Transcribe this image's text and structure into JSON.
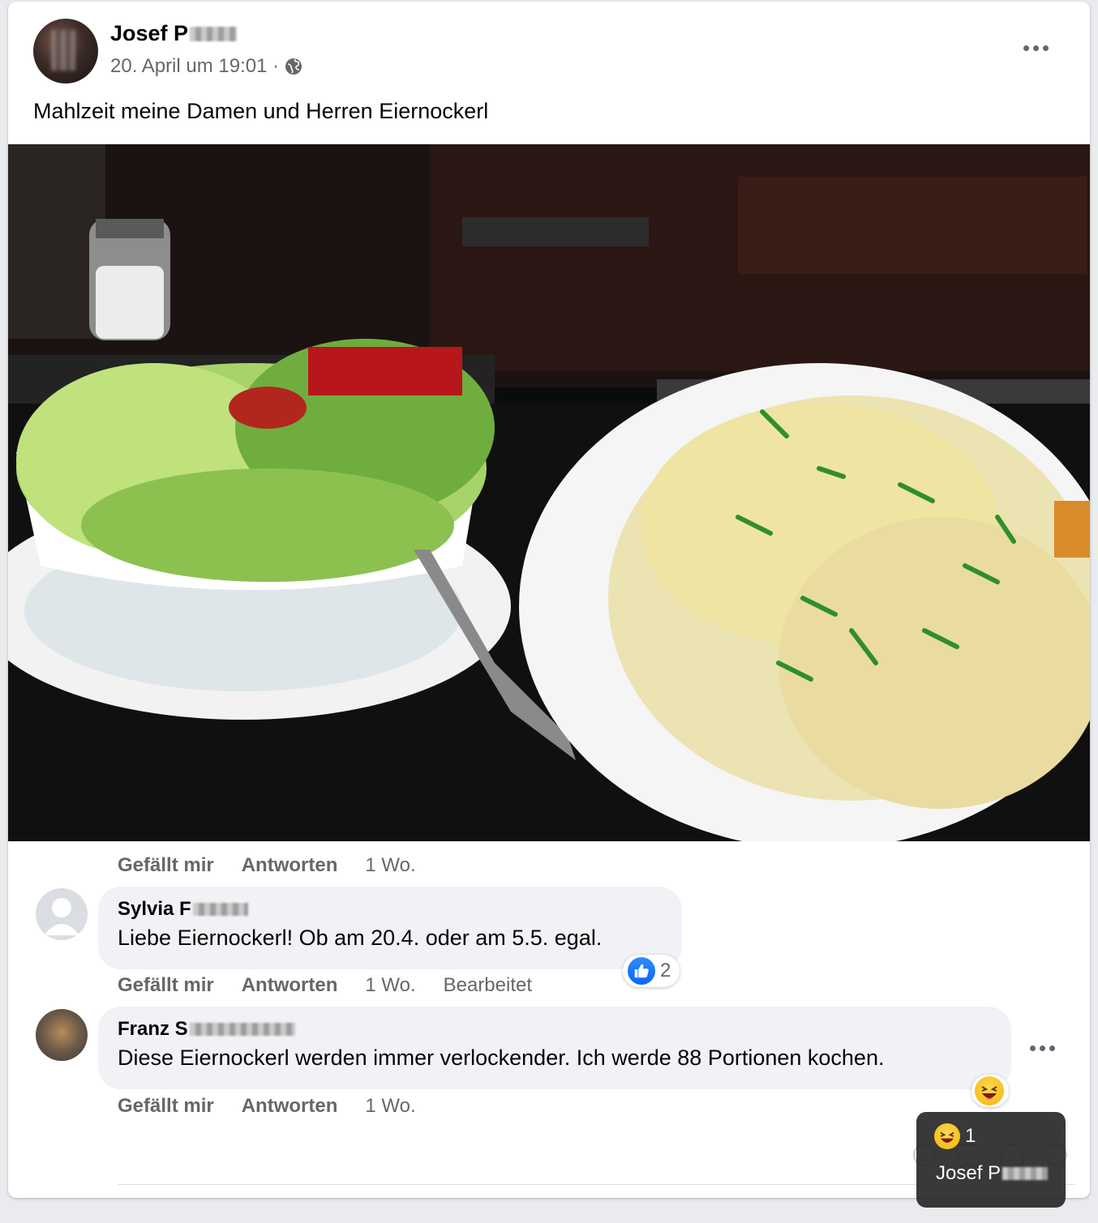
{
  "post": {
    "author": "Josef P",
    "timestamp": "20. April um 19:01 ·",
    "audience_icon": "globe-icon",
    "text": "Mahlzeit meine Damen und Herren Eiernockerl",
    "menu_icon": "more-horizontal-icon"
  },
  "comments": [
    {
      "author": "",
      "text": "",
      "actions": {
        "like": "Gefällt mir",
        "reply": "Antworten",
        "time": "1 Wo."
      }
    },
    {
      "author": "Sylvia F",
      "text": "Liebe Eiernockerl! Ob am 20.4. oder am 5.5. egal.",
      "reaction_count": "2",
      "reaction_icon": "like-icon",
      "actions": {
        "like": "Gefällt mir",
        "reply": "Antworten",
        "time": "1 Wo.",
        "edited": "Bearbeitet"
      }
    },
    {
      "author": "Franz S",
      "text": "Diese Eiernockerl werden immer verlockender. Ich werde 88 Portionen kochen.",
      "reaction_icon": "laughing-emoji-icon",
      "actions": {
        "like": "Gefällt mir",
        "reply": "Antworten",
        "time": "1 Wo."
      }
    }
  ],
  "tooltip": {
    "count": "1",
    "user": "Josef P"
  },
  "colors": {
    "secondary_text": "#65676b",
    "bubble": "#f0f2f5",
    "like_blue": "#0866ff"
  }
}
